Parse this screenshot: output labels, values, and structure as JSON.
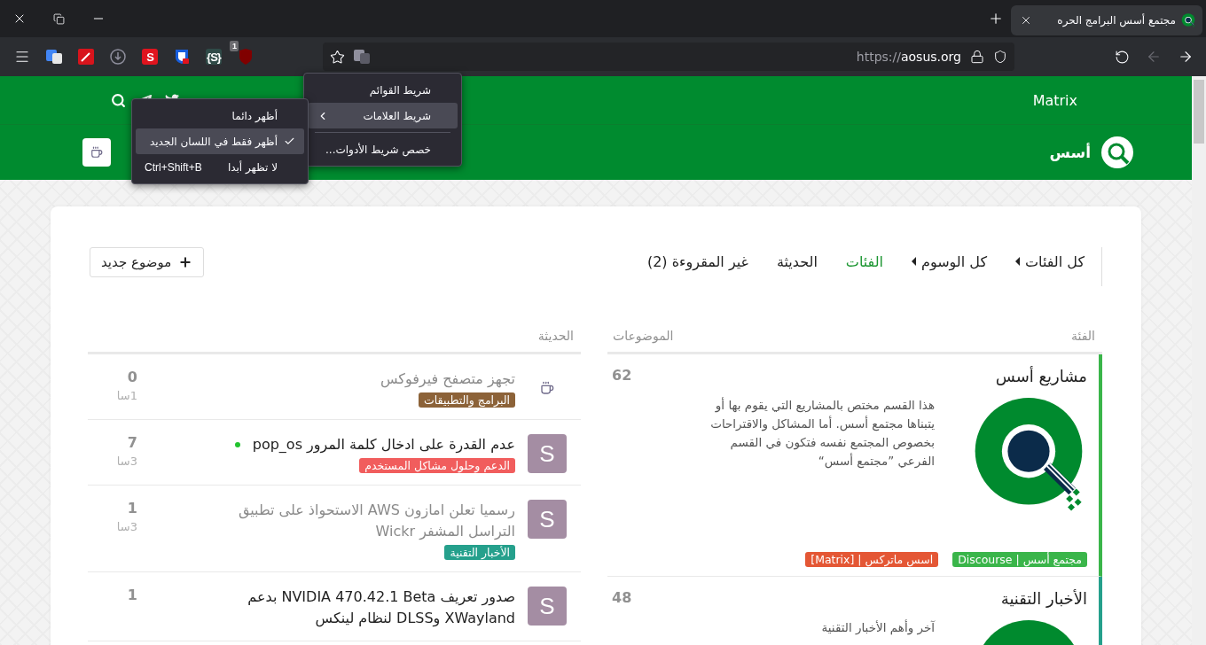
{
  "browser": {
    "tab": {
      "title": "مجتمع أسس البرامج الحره"
    },
    "extensions": [
      {
        "kind": "shield",
        "badge": "1"
      },
      {
        "kind": "letter",
        "label": "{S}",
        "color": "#2f4a47"
      },
      {
        "kind": "lock-shield"
      },
      {
        "kind": "letter",
        "label": "S",
        "color": "#e0141e"
      },
      {
        "kind": "download"
      },
      {
        "kind": "wand"
      },
      {
        "kind": "translate"
      }
    ],
    "url": {
      "scheme": "https://",
      "host": "aosus.org"
    },
    "forward_disabled": true
  },
  "toolbar_menu": {
    "items": [
      {
        "kind": "item",
        "label": "شريط القوائم",
        "highlighted": false
      },
      {
        "kind": "submenu",
        "label": "شريط العلامات",
        "highlighted": true
      },
      {
        "kind": "separator"
      },
      {
        "kind": "item",
        "label": "خصص شريط الأدوات...",
        "highlighted": false
      }
    ]
  },
  "bookmarks_submenu": {
    "items": [
      {
        "label": "أظهر دائما",
        "checked": false,
        "highlighted": false
      },
      {
        "label": "أظهر فقط في اللسان الجديد",
        "checked": true,
        "highlighted": true
      },
      {
        "label": "لا تظهر أبدا",
        "shortcut": "Ctrl+Shift+B",
        "checked": false,
        "highlighted": false
      }
    ]
  },
  "site_header": {
    "links": [
      "Matrix"
    ],
    "brand": "أسس"
  },
  "nav": {
    "items": [
      {
        "kind": "dropdown",
        "label": "كل الفئات",
        "selected": false
      },
      {
        "kind": "dropdown",
        "label": "كل الوسوم",
        "selected": false
      },
      {
        "kind": "link",
        "label": "الفئات",
        "selected": true
      },
      {
        "kind": "link",
        "label": "الحديثة",
        "selected": false
      },
      {
        "kind": "link",
        "label": "غير المقروءة (2)",
        "selected": false
      }
    ],
    "new_topic_button": "موضوع جديد"
  },
  "categories": {
    "columns": {
      "category": "الفئة",
      "topics": "الموضوعات"
    },
    "rows": [
      {
        "name": "مشاريع أسس",
        "description": "هذا القسم مختص بالمشاريع التي يقوم بها أو يتبناها مجتمع أسس. أما المشاكل والاقتراحات بخصوص المجتمع نفسه فتكون في القسم الفرعي ”مجتمع أسس“",
        "topics": "62",
        "color": "#3ab54a",
        "subcategories": [
          {
            "label": "مجتمع أسس | Discourse",
            "color": "#3ab54a"
          },
          {
            "label": "اسس ماتركس | [Matrix]",
            "color": "#e45735"
          }
        ]
      },
      {
        "name": "الأخبار التقنية",
        "description": "آخر وأهم الأخبار التقنية",
        "topics": "48",
        "color": "#25a08c"
      }
    ]
  },
  "latest": {
    "heading": "الحديثة",
    "rows": [
      {
        "avatar": {
          "kind": "icon"
        },
        "title": "تجهز متصفح فيرفوكس",
        "unread": false,
        "new_dot": false,
        "category": {
          "label": "البرامج والتطبيقات",
          "color": "#8c6238"
        },
        "count": "0",
        "age": "1سا"
      },
      {
        "avatar": {
          "kind": "letter",
          "letter": "S"
        },
        "title": "عدم القدرة على ادخال كلمة المرور pop_os",
        "unread": true,
        "new_dot": true,
        "category": {
          "label": "الدعم وحلول مشاكل المستخدم",
          "color": "#f15d5d"
        },
        "count": "7",
        "age": "3سا"
      },
      {
        "avatar": {
          "kind": "letter",
          "letter": "S"
        },
        "title": "رسميا تعلن امازون AWS الاستحواذ على تطبيق التراسل المشفر Wickr",
        "unread": false,
        "new_dot": false,
        "category": {
          "label": "الأخبار التقنية",
          "color": "#25a08c"
        },
        "count": "1",
        "age": "3سا"
      },
      {
        "avatar": {
          "kind": "letter",
          "letter": "S"
        },
        "title": "صدور تعريف NVIDIA 470.42.1 Beta بدعم XWayland وDLSS لنظام لينكس",
        "unread": true,
        "new_dot": false,
        "count": "1"
      }
    ]
  }
}
